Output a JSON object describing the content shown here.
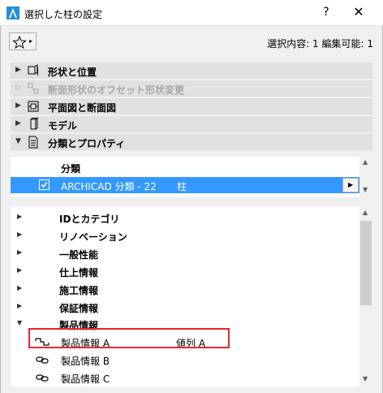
{
  "window": {
    "title": "選択した柱の設定",
    "help_label": "?",
    "close_label": "✕"
  },
  "toolbar": {
    "favorites_arrow": "▸",
    "selection_info": "選択内容: 1 編集可能: 1"
  },
  "sections": [
    {
      "label": "形状と位置",
      "toggle": "▶",
      "icon": "geometry-icon",
      "enabled": true
    },
    {
      "label": "断面形状のオフセット形状変更",
      "toggle": "▷",
      "icon": "offset-profile-icon",
      "enabled": false
    },
    {
      "label": "平面図と断面図",
      "toggle": "▶",
      "icon": "floor-plan-icon",
      "enabled": true
    },
    {
      "label": "モデル",
      "toggle": "▶",
      "icon": "model-icon",
      "enabled": true
    },
    {
      "label": "分類とプロパティ",
      "toggle": "▼",
      "icon": "classification-icon",
      "enabled": true
    }
  ],
  "classification": {
    "header": "分類",
    "row": {
      "checked": true,
      "name": "ARCHICAD 分類 - 22",
      "type": "柱",
      "expand_arrow": "▶"
    }
  },
  "properties": {
    "groups": [
      {
        "label": "IDとカテゴリ",
        "toggle": "▶"
      },
      {
        "label": "リノベーション",
        "toggle": "▶"
      },
      {
        "label": "一般性能",
        "toggle": "▶"
      },
      {
        "label": "仕上情報",
        "toggle": "▶"
      },
      {
        "label": "施工情報",
        "toggle": "▶"
      },
      {
        "label": "保証情報",
        "toggle": "▶"
      },
      {
        "label": "製品情報",
        "toggle": "▼"
      }
    ],
    "items": [
      {
        "label": "製品情報 A",
        "value": "値列 A",
        "icon": "link-icon"
      },
      {
        "label": "製品情報 B",
        "value": "",
        "icon": "chain-link-icon"
      },
      {
        "label": "製品情報 C",
        "value": "",
        "icon": "chain-link-icon"
      }
    ]
  },
  "scrollbar": {
    "up": "▲",
    "down": "▼"
  },
  "colors": {
    "selection": "#3399ff",
    "highlight_border": "#e8262f",
    "section_bg": "#e1e1e1"
  }
}
